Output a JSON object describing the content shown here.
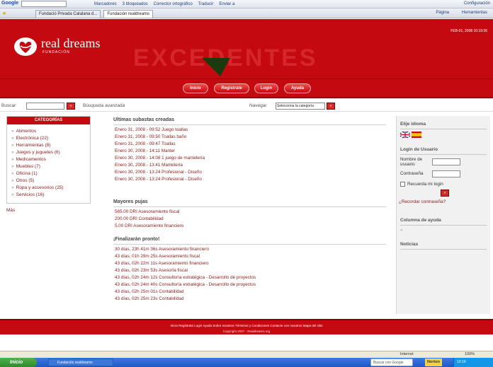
{
  "browser": {
    "google_label": "Google",
    "bookmarks": [
      "Marcadores",
      "3 bloqueados",
      "Corrector ortográfico",
      "Traducir",
      "Enviar a"
    ],
    "settings": "Configuración",
    "tabs": [
      "Fundació Privada Catalana d...",
      "Fundación realdreams"
    ],
    "tools": [
      "Página",
      "Herramientas"
    ]
  },
  "header": {
    "logo_title": "real dreams",
    "logo_sub": "FUNDACIÓN",
    "background_word": "EXCEDENTES",
    "datetime": "FEB-01, 2008 10:19:36"
  },
  "nav": {
    "inicio": "Inicio",
    "registrate": "Regístrate",
    "login": "Login",
    "ayuda": "Ayuda"
  },
  "search": {
    "label": "Buscar",
    "go": "»",
    "advanced": "Búsqueda avanzada",
    "navegar": "Navegar",
    "category_select": "Selecciona la categoría"
  },
  "categories": {
    "heading": "CATEGORÍAS",
    "items": [
      "Alimentos",
      "Electrónica (22)",
      "Herramientas (8)",
      "Juegos y juguetes (6)",
      "Medicamentos",
      "Muebles (7)",
      "Oficina (1)",
      "Otros (5)",
      "Ropa y accesorios (25)",
      "Servicios (16)"
    ],
    "more": "Más"
  },
  "auctions": {
    "heading": "Ultimas subastas creadas",
    "items": [
      "Enero 31, 2008 - 09:52 Juego toallas",
      "Enero 31, 2008 - 09:50 Toallas baño",
      "Enero 31, 2008 - 09:47 Toallas",
      "Enero 30, 2008 - 14:11 Mantel",
      "Enero 30, 2008 - 14:08 1 juego de mantelería",
      "Enero 30, 2008 - 13:41 Mantelería",
      "Enero 30, 2008 - 13:24 Profesional - Diseño",
      "Enero 30, 2008 - 13:24 Profesional - Diseño"
    ]
  },
  "bids": {
    "heading": "Mayores pujas",
    "items": [
      "565.00 DRI Asesoramiento fiscal",
      "200.00 DRI Contabilidad",
      "5.00 DRI Asesoramiento financiero"
    ]
  },
  "ending": {
    "heading": "¡Finalizarán pronto!",
    "items": [
      "30 días, 23h 41m 36s Asesoramiento financiero",
      "43 días, 01h 29m 25s Asesoramiento fiscal",
      "43 días, 02h 22m 11s Asesoramiento financiero",
      "43 días, 02h 23m 53s Asesoría fiscal",
      "43 días, 02h 24m 12s Consultoría estratégica - Desarrollo de proyectos",
      "43 días, 02h 24m 40s Consultoría estratégica - Desarrollo de proyectos",
      "43 días, 02h 25m 01s Contabilidad",
      "43 días, 02h 25m 23s Contabilidad"
    ]
  },
  "sidebar": {
    "language_heading": "Elije idioma",
    "login_heading": "Login de Usuario",
    "username_label": "Nombre de usuario",
    "password_label": "Contraseña",
    "remember_label": "Recuerda mi login",
    "submit": "»",
    "forgot": "¿Recordar contraseña?",
    "help_heading": "Columna de ayuda",
    "help_arrow": "»",
    "news_heading": "Noticias"
  },
  "footer": {
    "links": "Inicio  Regístrate  Login  Ayuda  Sobre nosotros  Términos y Condiciones  Contacte con nosotros  Mapa del sitio",
    "copyright": "Copyright 2007 - Realdreams.org"
  },
  "status": {
    "internet": "Internet",
    "zoom": "100%"
  },
  "taskbar": {
    "start": "Inicio",
    "window": "Fundación realdreams",
    "search": "Buscar con Google",
    "norton": "Norton",
    "clock": "10:19"
  },
  "colors": {
    "brand_red": "#c40a10",
    "link": "#8a1a1a",
    "annotation_arrow": "#1a3a10"
  }
}
